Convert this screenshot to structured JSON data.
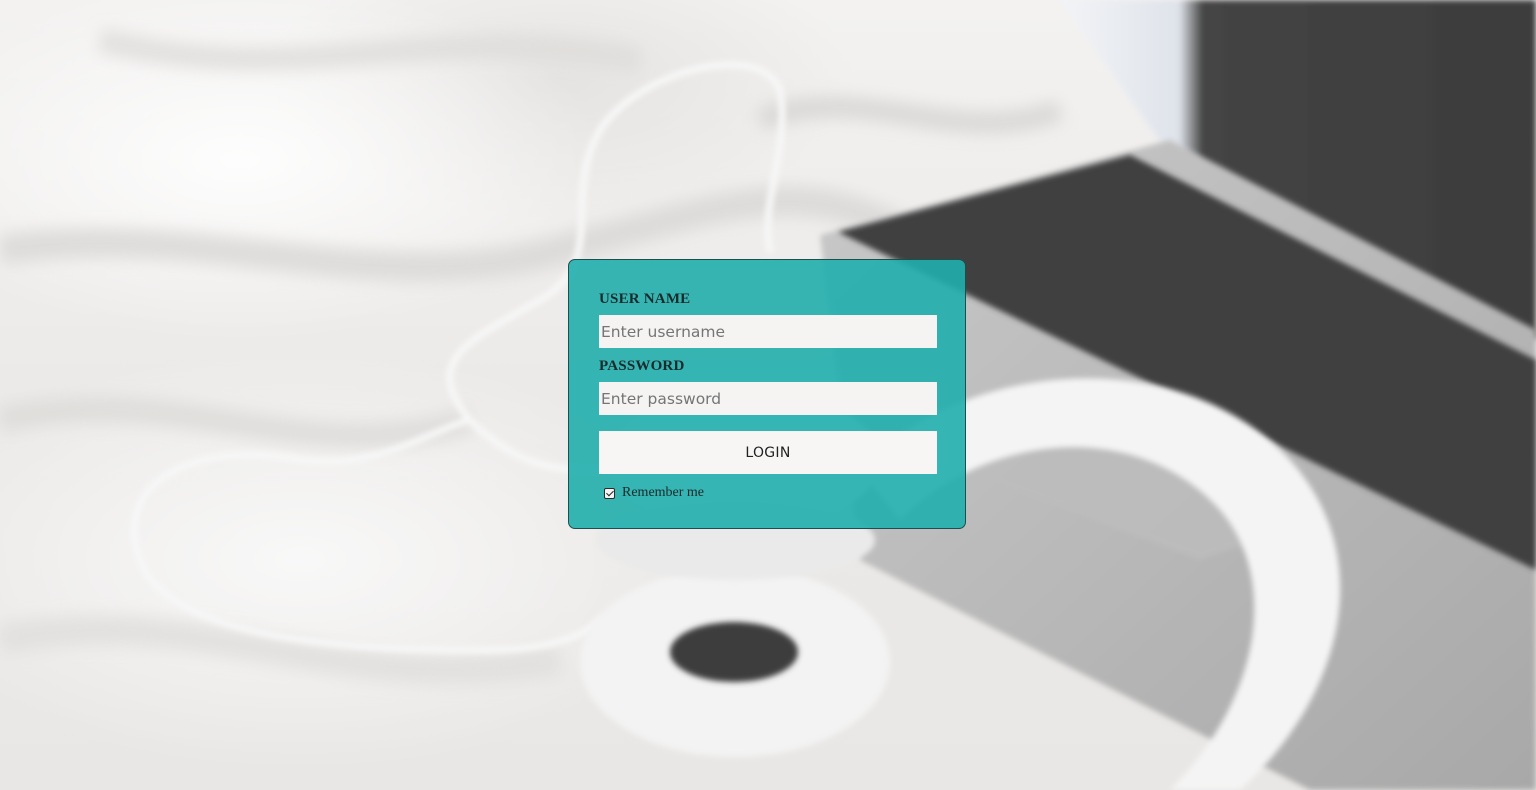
{
  "login": {
    "username_label": "USER NAME",
    "username_placeholder": "Enter username",
    "username_value": "",
    "password_label": "PASSWORD",
    "password_placeholder": "Enter password",
    "password_value": "",
    "button_label": "LOGIN",
    "remember_label": "Remember me",
    "remember_checked": true
  },
  "theme": {
    "card_color": "#20aeac",
    "card_border": "#1e4e4d",
    "input_background": "#f5f4f3"
  },
  "background": {
    "scene": [
      "bedsheet",
      "headphones-icon",
      "laptop-icon"
    ]
  }
}
